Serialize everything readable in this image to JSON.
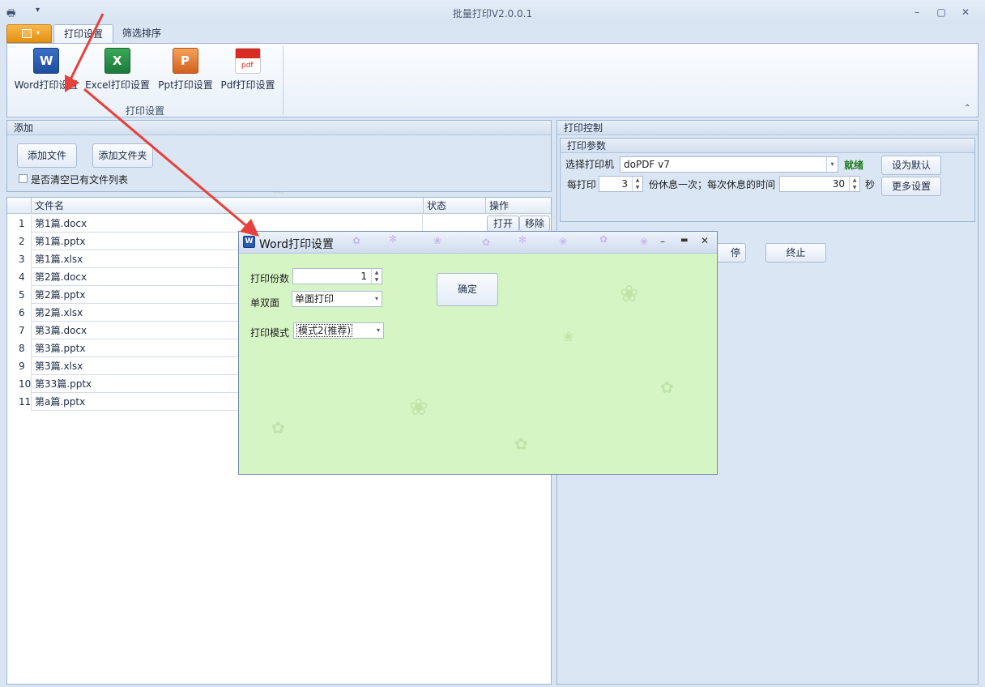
{
  "window": {
    "title": "批量打印V2.0.0.1"
  },
  "tabs": {
    "print_settings": "打印设置",
    "filter_sort": "筛选排序"
  },
  "ribbon": {
    "buttons": [
      {
        "label": "Word打印设置",
        "icon": "word-icon"
      },
      {
        "label": "Excel打印设置",
        "icon": "excel-icon"
      },
      {
        "label": "Ppt打印设置",
        "icon": "ppt-icon"
      },
      {
        "label": "Pdf打印设置",
        "icon": "pdf-icon"
      }
    ],
    "group_label": "打印设置"
  },
  "add_panel": {
    "title": "添加",
    "add_file": "添加文件",
    "add_folder": "添加文件夹",
    "clear_checkbox": "是否清空已有文件列表"
  },
  "grid": {
    "headers": {
      "filename": "文件名",
      "status": "状态",
      "action": "操作"
    },
    "action_open": "打开",
    "action_remove": "移除",
    "rows": [
      {
        "n": "1",
        "name": "第1篇.docx"
      },
      {
        "n": "2",
        "name": "第1篇.pptx"
      },
      {
        "n": "3",
        "name": "第1篇.xlsx"
      },
      {
        "n": "4",
        "name": "第2篇.docx"
      },
      {
        "n": "5",
        "name": "第2篇.pptx"
      },
      {
        "n": "6",
        "name": "第2篇.xlsx"
      },
      {
        "n": "7",
        "name": "第3篇.docx"
      },
      {
        "n": "8",
        "name": "第3篇.pptx"
      },
      {
        "n": "9",
        "name": "第3篇.xlsx"
      },
      {
        "n": "10",
        "name": "第33篇.pptx"
      },
      {
        "n": "11",
        "name": "第a篇.pptx"
      }
    ]
  },
  "print_control": {
    "title": "打印控制",
    "params_title": "打印参数",
    "printer_label": "选择打印机",
    "printer_value": "doPDF v7",
    "status": "就绪",
    "set_default": "设为默认",
    "every_label": "每打印",
    "every_value": "3",
    "rest_text": "份休息一次；每次休息的时间",
    "rest_value": "30",
    "seconds": "秒",
    "more_settings": "更多设置",
    "pause_partial": "停",
    "stop": "终止"
  },
  "dialog": {
    "title": "Word打印设置",
    "copies_label": "打印份数",
    "copies_value": "1",
    "duplex_label": "单双面",
    "duplex_value": "单面打印",
    "mode_label": "打印模式",
    "mode_value": "模式2(推荐)",
    "ok": "确定"
  },
  "colors": {
    "status_ready": "#1a7a1a",
    "dialog_bg": "#d6f5c4",
    "annotation_arrow": "#e8403a"
  }
}
